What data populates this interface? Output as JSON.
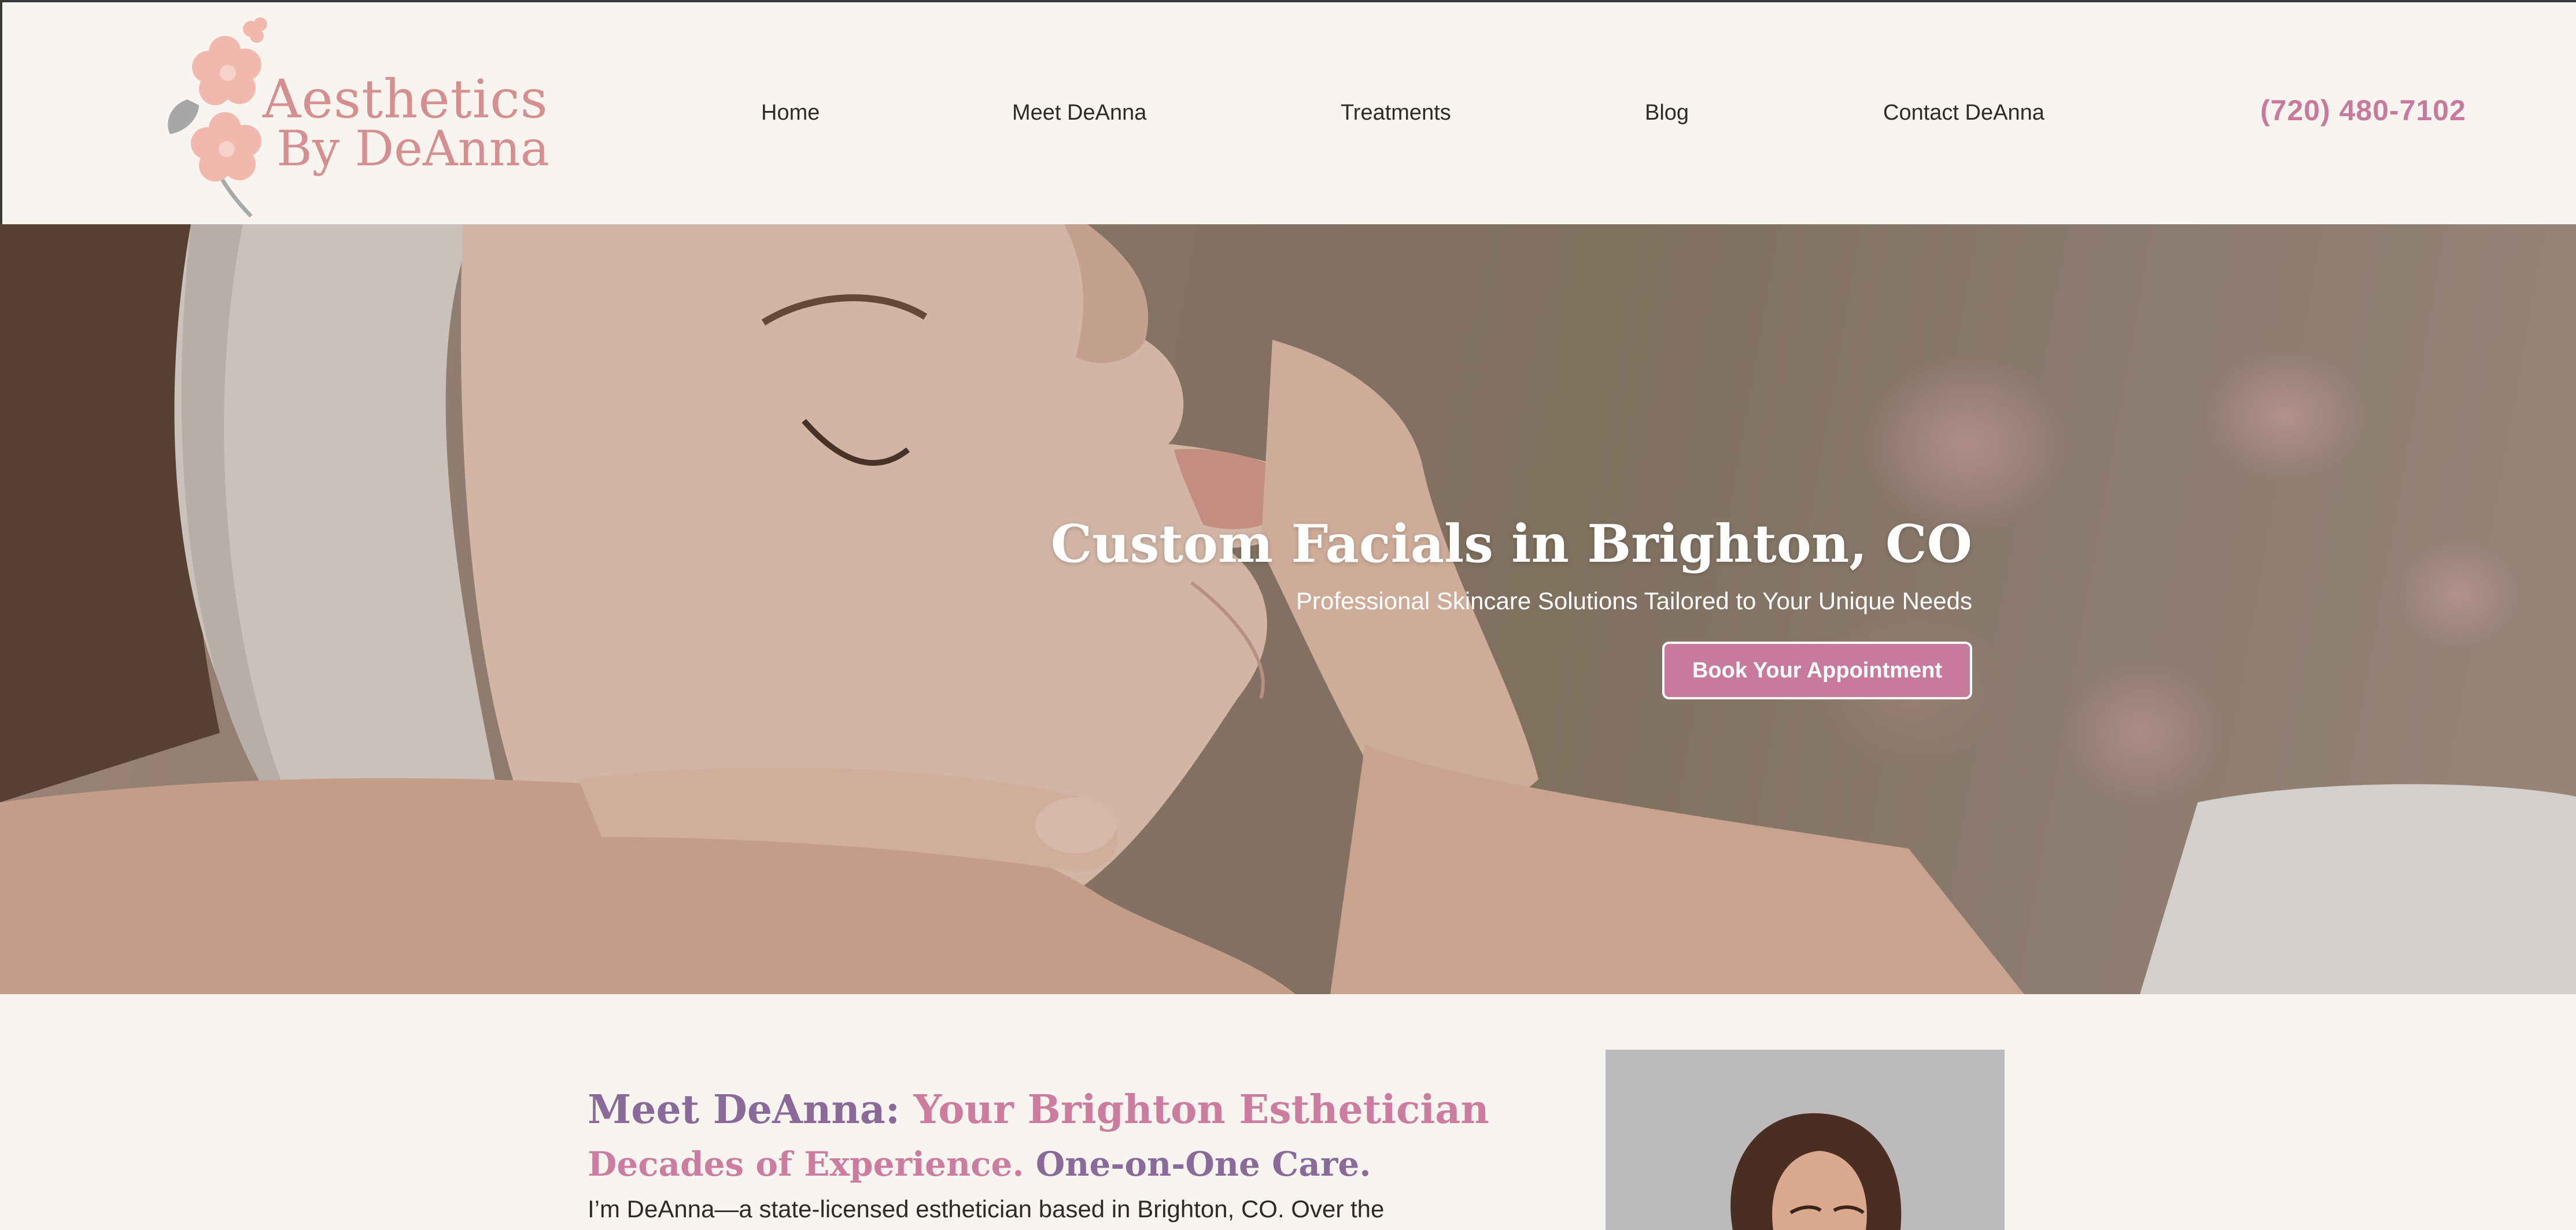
{
  "brand": {
    "line1": "Aesthetics",
    "line2": "By DeAnna",
    "color": "#d58f8e"
  },
  "nav": {
    "items": [
      {
        "label": "Home"
      },
      {
        "label": "Meet DeAnna"
      },
      {
        "label": "Treatments"
      },
      {
        "label": "Blog"
      },
      {
        "label": "Contact DeAnna"
      }
    ],
    "phone": "(720) 480-7102"
  },
  "hero": {
    "title": "Custom Facials in Brighton, CO",
    "subtitle": "Professional Skincare Solutions Tailored to Your Unique Needs",
    "cta_label": "Book Your Appointment",
    "cta_color": "#c77a9b"
  },
  "meet": {
    "heading_part1": "Meet DeAnna:",
    "heading_part2": "Your Brighton Esthetician",
    "subheading_part1": "Decades of Experience.",
    "subheading_part2": "One-on-One Care.",
    "paragraph": "I’m DeAnna—a state-licensed esthetician based in Brighton, CO. Over the",
    "accent_purple": "#8a6a9a",
    "accent_pink": "#cc7c9e"
  },
  "icons": [
    "cherry-blossom-icon"
  ]
}
